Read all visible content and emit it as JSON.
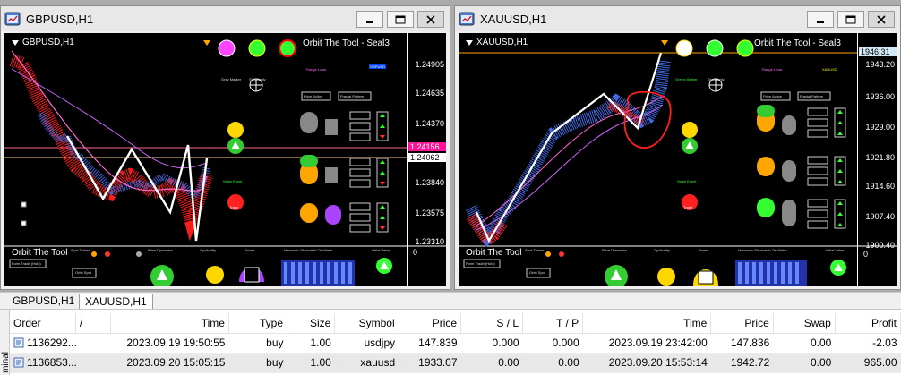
{
  "windows": [
    {
      "title": "GBPUSD,H1",
      "chart_symbol": "GBPUSD,H1",
      "ea_name": "Orbit The Tool - Seal3",
      "price_ticks": [
        "1.24905",
        "1.24635",
        "1.24370",
        "1.23840",
        "1.23575",
        "1.23310"
      ],
      "bid_tag": "1.24156",
      "ask_tag": "1.24062",
      "subwindow_label": "Orbit The Tool",
      "subwindow_zero": "0",
      "hud_badge": "GBPUSD"
    },
    {
      "title": "XAUUSD,H1",
      "chart_symbol": "XAUUSD,H1",
      "ea_name": "Orbit The Tool - Seal3",
      "price_ticks": [
        "1943.20",
        "1936.00",
        "1929.00",
        "1921.80",
        "1914.60",
        "1907.40",
        "1900.40"
      ],
      "bid_tag": "1946.31",
      "subwindow_label": "Orbit The Tool",
      "subwindow_zero": "0",
      "hud_badge": "XAUUSD"
    }
  ],
  "hud_labels": {
    "gray_marker": "Grey Marker",
    "green_marker": "Green Marker",
    "singularity": "Singularity",
    "price_action": "Price Action",
    "fractal_pattern": "Fractal Pattern",
    "range_lows": "Range Lows",
    "spike_event": "Spike Event",
    "trade": "Trade",
    "spot_trades": "Spot Trades",
    "price_dynamics": "Price Dynamics",
    "cyclicality": "Cyclicality",
    "power": "Power",
    "harmonic_oscillator": "Harmonic Stochastic Oscillator",
    "initial_value": "Initial Value",
    "form_trade": "Form Trade (Hold)",
    "orbit_spot": "Orbit Spot"
  },
  "tabs": [
    {
      "label": "GBPUSD,H1",
      "active": false
    },
    {
      "label": "XAUUSD,H1",
      "active": true
    }
  ],
  "terminal": {
    "side_label": "minal",
    "columns": [
      "Order",
      "/",
      "Time",
      "Type",
      "Size",
      "Symbol",
      "Price",
      "S / L",
      "T / P",
      "Time",
      "Price",
      "Swap",
      "Profit"
    ],
    "rows": [
      {
        "order": "1136292...",
        "open_time": "2023.09.19 19:50:55",
        "type": "buy",
        "size": "1.00",
        "symbol": "usdjpy",
        "price": "147.839",
        "sl": "0.000",
        "tp": "0.000",
        "close_time": "2023.09.19 23:42:00",
        "close_price": "147.836",
        "swap": "0.00",
        "profit": "-2.03",
        "selected": false
      },
      {
        "order": "1136853...",
        "open_time": "2023.09.20 15:05:15",
        "type": "buy",
        "size": "1.00",
        "symbol": "xauusd",
        "price": "1933.07",
        "sl": "0.00",
        "tp": "0.00",
        "close_time": "2023.09.20 15:53:14",
        "close_price": "1942.72",
        "swap": "0.00",
        "profit": "965.00",
        "selected": true
      }
    ]
  },
  "colors": {
    "chart_bg": "#000000",
    "bull": "#4169e1",
    "bear": "#ff2020",
    "zigzag": "#ffffff",
    "ma": "#ff66cc",
    "hline": "#ff4466",
    "bid_tag_bg": "#ff1493",
    "ask_tag_bg": "#ffffff",
    "gold_line": "#ffa500"
  }
}
